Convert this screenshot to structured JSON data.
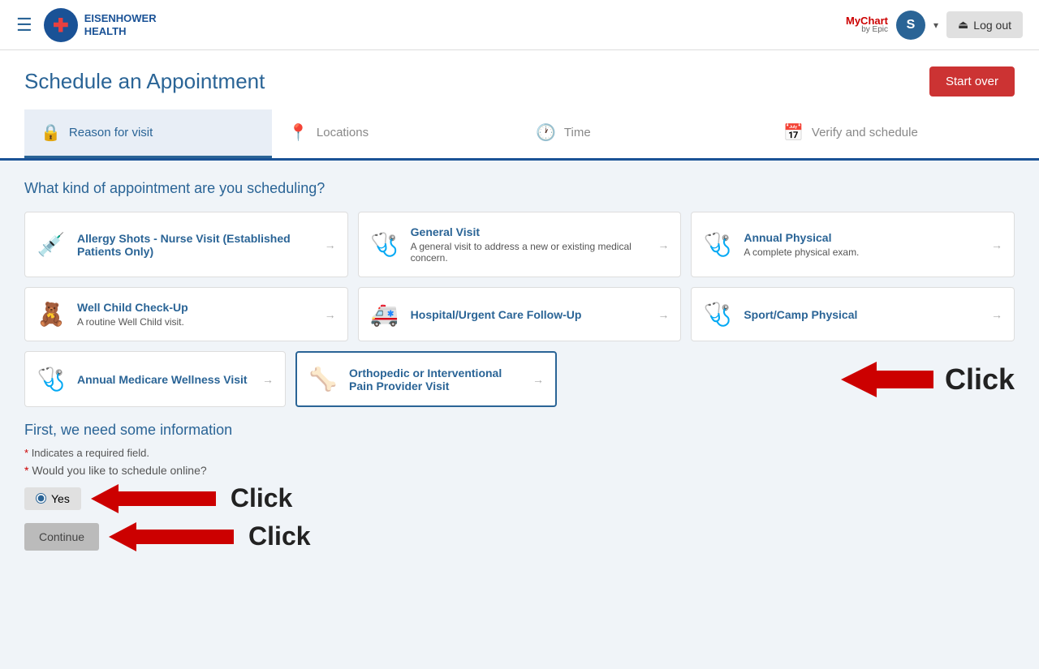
{
  "header": {
    "hamburger_icon": "☰",
    "logo_text_line1": "EISENHOWER",
    "logo_text_line2": "HEALTH",
    "mychart_text": "MyChart",
    "epic_text": "by Epic",
    "user_initial": "S",
    "logout_label": "Log out"
  },
  "page": {
    "title": "Schedule an Appointment",
    "start_over_label": "Start over"
  },
  "steps": [
    {
      "label": "Reason for visit",
      "icon": "🔒",
      "active": true
    },
    {
      "label": "Locations",
      "icon": "📍",
      "active": false
    },
    {
      "label": "Time",
      "icon": "🕐",
      "active": false
    },
    {
      "label": "Verify and schedule",
      "icon": "📅",
      "active": false
    }
  ],
  "appointment_section": {
    "question": "What kind of appointment are you scheduling?",
    "cards": [
      {
        "id": "allergy-shots",
        "icon": "💉",
        "title": "Allergy Shots - Nurse Visit (Established Patients Only)",
        "description": "",
        "selected": false
      },
      {
        "id": "general-visit",
        "icon": "🩺",
        "title": "General Visit",
        "description": "A general visit to address a new or existing medical concern.",
        "selected": false
      },
      {
        "id": "annual-physical",
        "icon": "🩺",
        "title": "Annual Physical",
        "description": "A complete physical exam.",
        "selected": false
      },
      {
        "id": "well-child",
        "icon": "🧸",
        "title": "Well Child Check-Up",
        "description": "A routine Well Child visit.",
        "selected": false
      },
      {
        "id": "hospital-followup",
        "icon": "🚑",
        "title": "Hospital/Urgent Care Follow-Up",
        "description": "",
        "selected": false
      },
      {
        "id": "sport-camp",
        "icon": "🩺",
        "title": "Sport/Camp Physical",
        "description": "",
        "selected": false
      },
      {
        "id": "annual-medicare",
        "icon": "🩺",
        "title": "Annual Medicare Wellness Visit",
        "description": "",
        "selected": false
      },
      {
        "id": "orthopedic",
        "icon": "🦴",
        "title": "Orthopedic or Interventional Pain Provider Visit",
        "description": "",
        "selected": true
      }
    ]
  },
  "info_section": {
    "title": "First, we need some information",
    "required_note": "Indicates a required field.",
    "schedule_online_label": "Would you like to schedule online?",
    "yes_label": "Yes",
    "continue_label": "Continue"
  },
  "annotations": {
    "click1": "Click",
    "click2": "Click",
    "click3": "Click"
  }
}
